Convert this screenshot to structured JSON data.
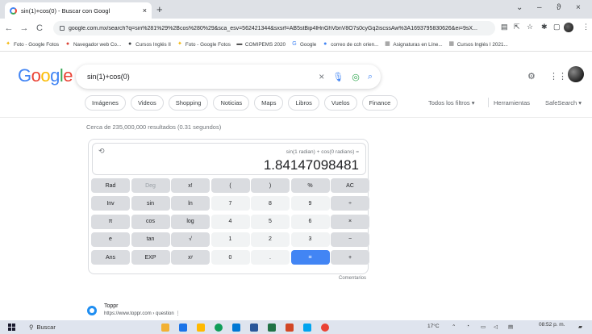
{
  "browser": {
    "tab_title": "sin(1)+cos(0) - Buscar con Googl",
    "tab_close": "×",
    "new_tab": "+",
    "win_minimize": "–",
    "win_restore": "ϑ",
    "win_close": "×",
    "win_chevron": "⌄",
    "url": "google.com.mx/search?q=sin%281%29%2Bcos%280%29&sca_esv=562421344&sxsrf=AB5stBip4lHnGhVbnV8O7s0cyGq2iscssAw%3A1693795830626&ei=9sX...",
    "nav_back": "←",
    "nav_forward": "→",
    "nav_reload": "C"
  },
  "bookmarks": [
    {
      "label": "Foto - Google Fotos",
      "icon": "✦",
      "color": "#f4b400"
    },
    {
      "label": "Navegador web Co...",
      "icon": "●",
      "color": "#db4437"
    },
    {
      "label": "Cursos Inglés II",
      "icon": "●",
      "color": "#3c4043"
    },
    {
      "label": "Foto - Google Fotos",
      "icon": "✦",
      "color": "#f4b400"
    },
    {
      "label": "COMIPEMS 2020",
      "icon": "▬",
      "color": "#555"
    },
    {
      "label": "Google",
      "icon": "G",
      "color": "#4285f4"
    },
    {
      "label": "correo de cch orien...",
      "icon": "●",
      "color": "#4285f4"
    },
    {
      "label": "Asignaturas en Líne...",
      "icon": "▦",
      "color": "#777"
    },
    {
      "label": "Cursos Inglés I 2021...",
      "icon": "▦",
      "color": "#777"
    }
  ],
  "google": {
    "logo_letters": [
      "G",
      "o",
      "o",
      "g",
      "l",
      "e"
    ],
    "logo_colors": [
      "#4285f4",
      "#ea4335",
      "#fbbc05",
      "#4285f4",
      "#34a853",
      "#ea4335"
    ],
    "query": "sin(1)+cos(0)",
    "clear": "×",
    "search_icon": "🔍"
  },
  "filters": {
    "chips": [
      "Imágenes",
      "Videos",
      "Shopping",
      "Noticias",
      "Maps",
      "Libros",
      "Vuelos",
      "Finance"
    ],
    "all_filters": "Todos los filtros ▾",
    "tools": "Herramientas",
    "safesearch": "SafeSearch ▾"
  },
  "stats": "Cerca de 235,000,000 resultados (0.31 segundos)",
  "calculator": {
    "history_icon": "⟲",
    "expression": "sin(1 radian) + cos(0 radians) =",
    "result": "1.84147098481",
    "keys": [
      {
        "label": "Rad",
        "style": "dark"
      },
      {
        "label": "Deg",
        "style": "dark-deg"
      },
      {
        "label": "x!",
        "style": "dark"
      },
      {
        "label": "(",
        "style": "dark"
      },
      {
        "label": ")",
        "style": "dark"
      },
      {
        "label": "%",
        "style": "dark"
      },
      {
        "label": "AC",
        "style": "dark"
      },
      {
        "label": "Inv",
        "style": "dark"
      },
      {
        "label": "sin",
        "style": "dark"
      },
      {
        "label": "ln",
        "style": "dark"
      },
      {
        "label": "7",
        "style": "light"
      },
      {
        "label": "8",
        "style": "light"
      },
      {
        "label": "9",
        "style": "light"
      },
      {
        "label": "÷",
        "style": "dark"
      },
      {
        "label": "π",
        "style": "dark"
      },
      {
        "label": "cos",
        "style": "dark"
      },
      {
        "label": "log",
        "style": "dark"
      },
      {
        "label": "4",
        "style": "light"
      },
      {
        "label": "5",
        "style": "light"
      },
      {
        "label": "6",
        "style": "light"
      },
      {
        "label": "×",
        "style": "dark"
      },
      {
        "label": "e",
        "style": "dark"
      },
      {
        "label": "tan",
        "style": "dark"
      },
      {
        "label": "√",
        "style": "dark"
      },
      {
        "label": "1",
        "style": "light"
      },
      {
        "label": "2",
        "style": "light"
      },
      {
        "label": "3",
        "style": "light"
      },
      {
        "label": "−",
        "style": "dark"
      },
      {
        "label": "Ans",
        "style": "dark"
      },
      {
        "label": "EXP",
        "style": "dark"
      },
      {
        "label": "xʸ",
        "style": "dark"
      },
      {
        "label": "0",
        "style": "light"
      },
      {
        "label": ".",
        "style": "light"
      },
      {
        "label": "=",
        "style": "blue"
      },
      {
        "label": "+",
        "style": "dark"
      }
    ],
    "comments": "Comentarios"
  },
  "result_item": {
    "site": "Toppr",
    "url": "https://www.toppr.com › question  ⋮"
  },
  "taskbar": {
    "search_label": "Buscar",
    "temperature": "17°C",
    "time": "08:52 p. m."
  }
}
